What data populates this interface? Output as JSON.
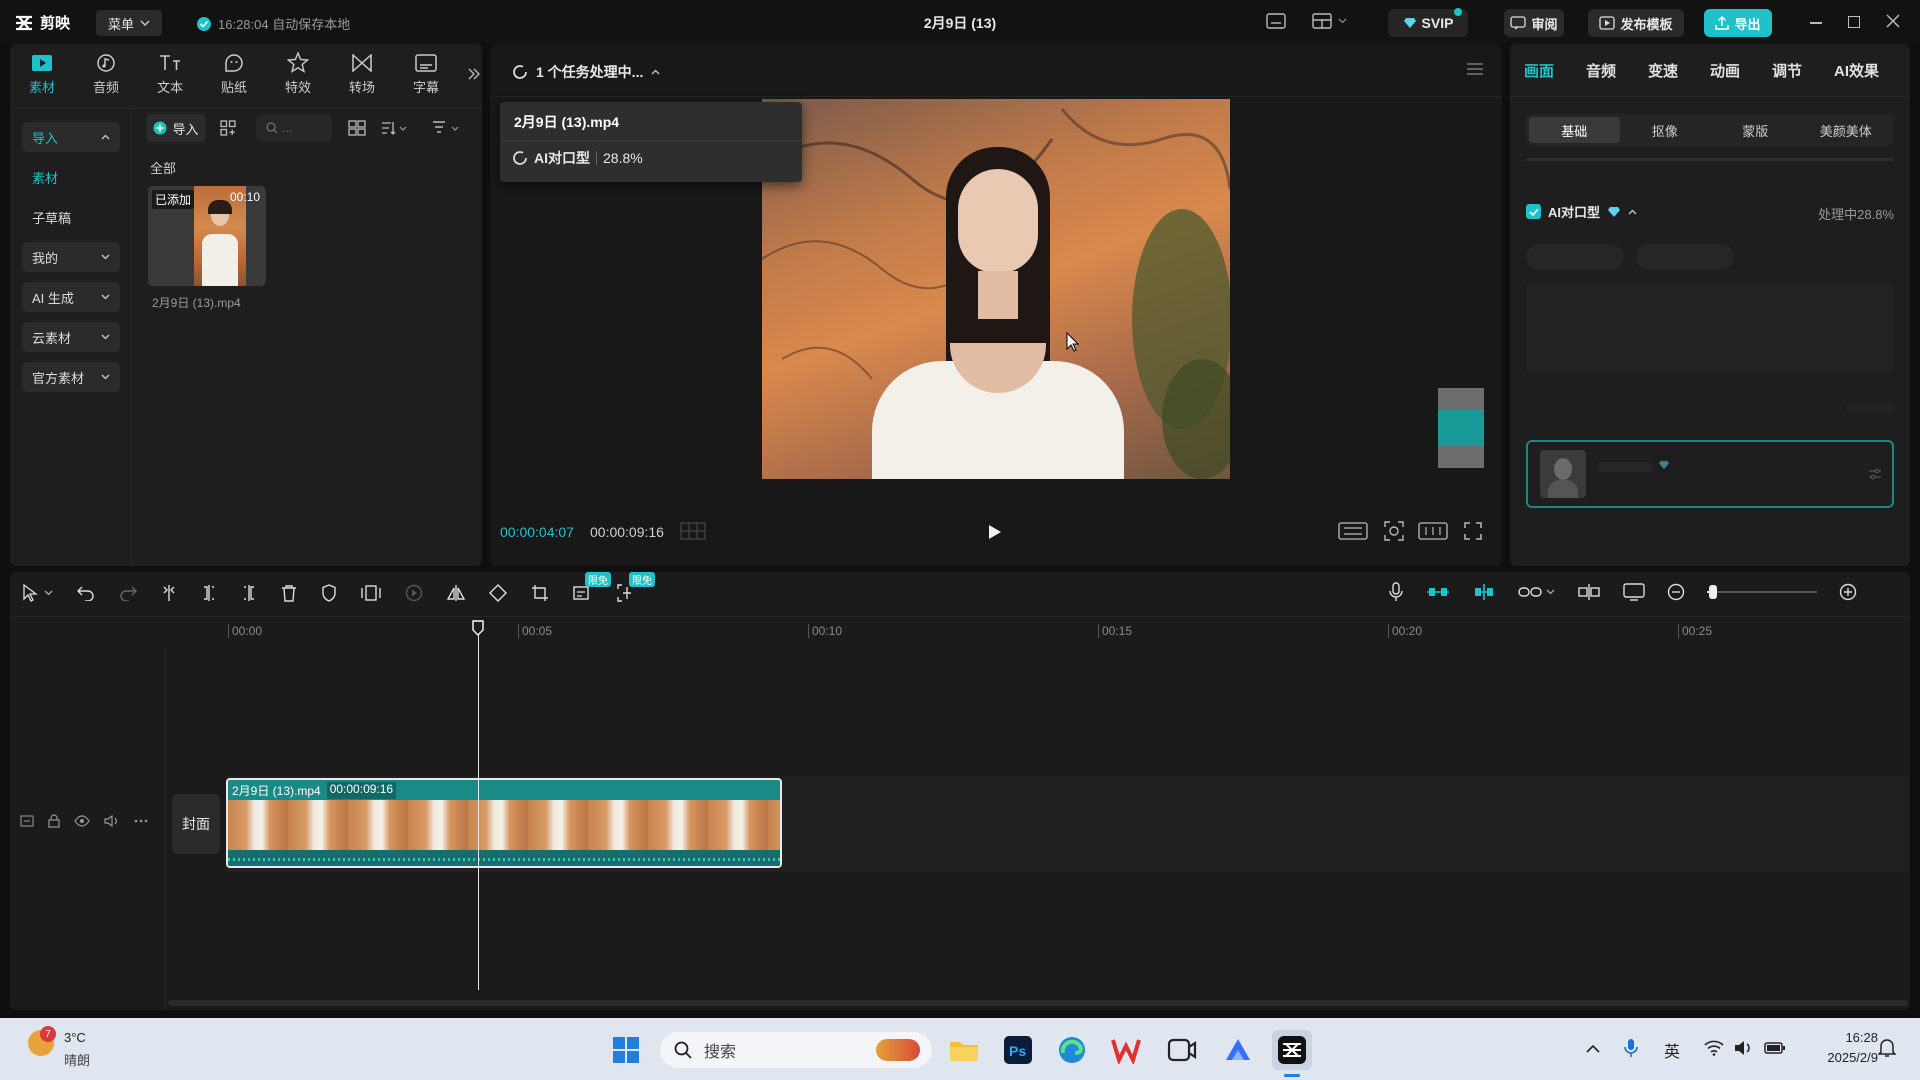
{
  "titlebar": {
    "app_name": "剪映",
    "menu_label": "菜单",
    "autosave": "16:28:04 自动保存本地",
    "project_title": "2月9日 (13)",
    "svip": "SVIP",
    "review": "审阅",
    "publish_template": "发布模板",
    "export": "导出"
  },
  "tools": [
    {
      "label": "素材",
      "icon": "media-icon"
    },
    {
      "label": "音频",
      "icon": "audio-icon"
    },
    {
      "label": "文本",
      "icon": "text-icon"
    },
    {
      "label": "贴纸",
      "icon": "sticker-icon"
    },
    {
      "label": "特效",
      "icon": "effects-icon"
    },
    {
      "label": "转场",
      "icon": "transition-icon"
    },
    {
      "label": "字幕",
      "icon": "subtitle-icon"
    }
  ],
  "sidebar": {
    "items": [
      {
        "label": "导入"
      },
      {
        "label": "素材"
      },
      {
        "label": "子草稿"
      },
      {
        "label": "我的"
      },
      {
        "label": "AI 生成"
      },
      {
        "label": "云素材"
      },
      {
        "label": "官方素材"
      }
    ]
  },
  "media": {
    "import_button": "导入",
    "search_placeholder": "...",
    "filter_all": "全部",
    "clip_badge": "已添加",
    "clip_duration": "00:10",
    "clip_name": "2月9日 (13).mp4"
  },
  "player": {
    "task_status": "1 个任务处理中...",
    "task_file": "2月9日 (13).mp4",
    "task_name": "AI对口型",
    "task_progress": "28.8%",
    "current_time": "00:00:04:07",
    "total_time": "00:00:09:16"
  },
  "inspector": {
    "tabs": [
      "画面",
      "音频",
      "变速",
      "动画",
      "调节",
      "AI效果"
    ],
    "subtabs": [
      "基础",
      "抠像",
      "蒙版",
      "美颜美体"
    ],
    "feature_name": "AI对口型",
    "feature_status": "处理中28.8%"
  },
  "timeline": {
    "free_badge_1": "限免",
    "free_badge_2": "限免",
    "ticks": [
      "00:00",
      "00:05",
      "00:10",
      "00:15",
      "00:20",
      "00:25"
    ],
    "cover_label": "封面",
    "clip_name": "2月9日 (13).mp4",
    "clip_duration": "00:00:09:16"
  },
  "taskbar": {
    "weather_temp": "3°C",
    "weather_desc": "晴朗",
    "weather_badge": "7",
    "search_label": "搜索",
    "ime": "英",
    "time": "16:28",
    "date": "2025/2/9"
  },
  "colors": {
    "accent": "#20c4cb",
    "clip_teal": "#1a8a86",
    "export_teal": "#1fc2c8"
  }
}
